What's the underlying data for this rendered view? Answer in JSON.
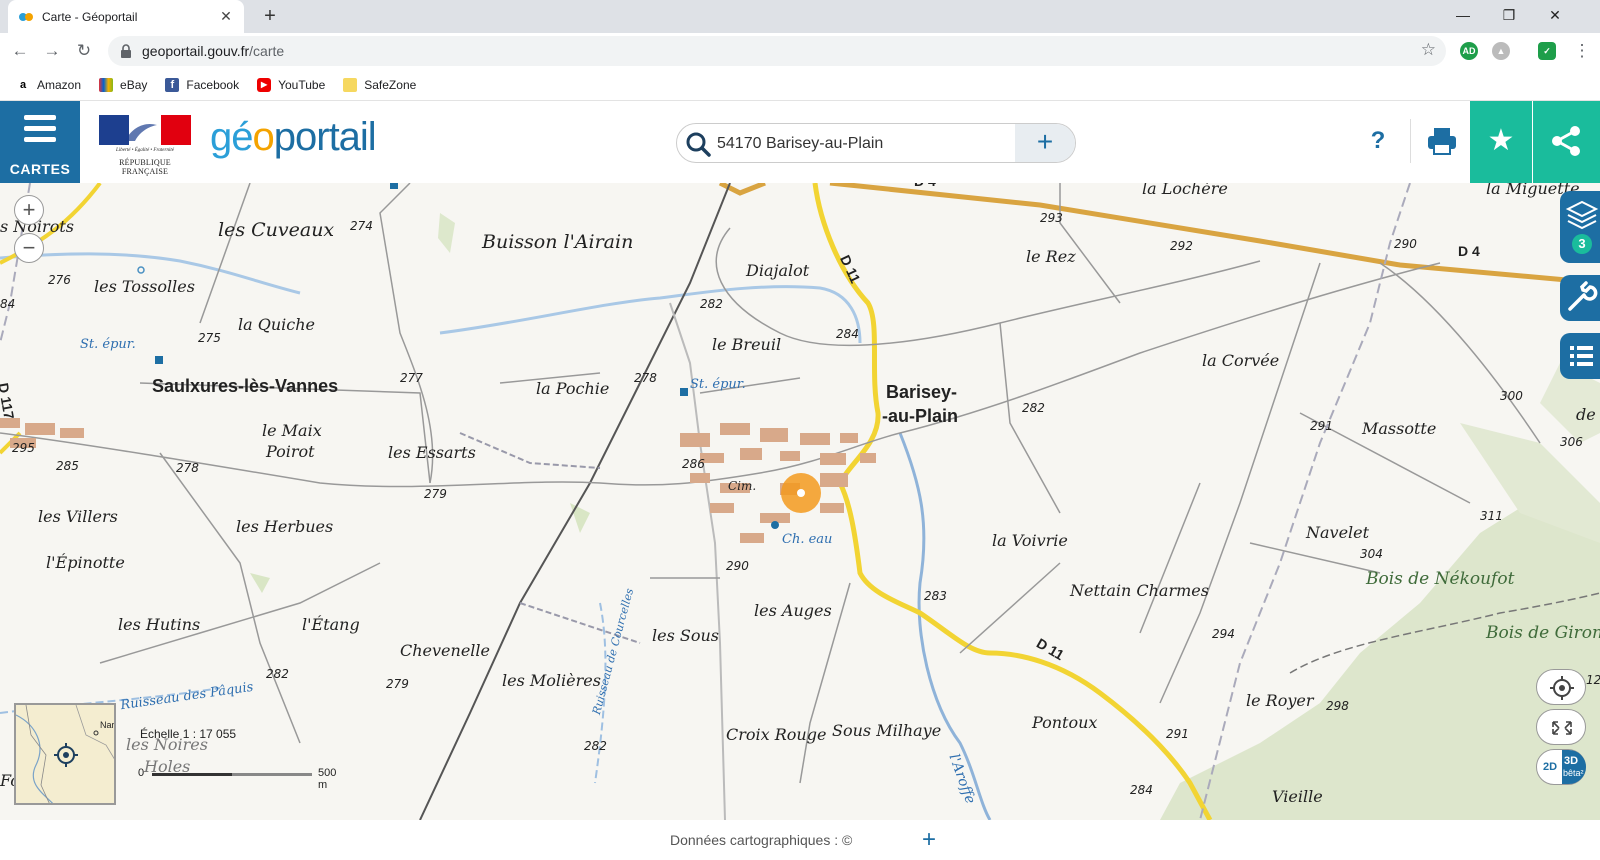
{
  "browser": {
    "tab_title": "Carte - Géoportail",
    "url_host": "geoportail.gouv.fr",
    "url_path": "/carte",
    "bookmarks": [
      "Amazon",
      "eBay",
      "Facebook",
      "YouTube",
      "SafeZone"
    ]
  },
  "header": {
    "menu_label": "CARTES",
    "rf_motto": "Liberté • Égalité • Fraternité",
    "rf_name": "RÉPUBLIQUE FRANÇAISE",
    "logo": {
      "part1": "gé",
      "part2": "o",
      "part3": "portail"
    },
    "search_value": "54170 Barisey-au-Plain",
    "help_label": "?"
  },
  "map": {
    "towns": {
      "saulxures": "Saulxures-lès-Vannes",
      "barisey1": "Barisey-",
      "barisey2": "-au-Plain"
    },
    "places": {
      "noirots": "s Noirots",
      "cuveaux": "les Cuveaux",
      "buisson": "Buisson l'Airain",
      "diajalot": "Diajalot",
      "lochere": "la Lochère",
      "miguette": "la Miguette",
      "rez": "le Rez",
      "tossolles": "les Tossolles",
      "quiche": "la Quiche",
      "breuil": "le Breuil",
      "pochie": "la Pochie",
      "corvee": "la Corvée",
      "maix1": "le Maix",
      "maix2": "Poirot",
      "essarts": "les Essarts",
      "massotte": "Massotte",
      "villers": "les Villers",
      "herbues": "les Herbues",
      "voivrie": "la Voivrie",
      "navelet": "Navelet",
      "epinotte": "l'Épinotte",
      "nettain": "Nettain Charmes",
      "auges": "les Auges",
      "sous": "les Sous",
      "hutins": "les Hutins",
      "etang": "l'Étang",
      "chevenelle": "Chevenelle",
      "molieres": "les Molières",
      "royer": "le Royer",
      "pontoux": "Pontoux",
      "croix": "Croix Rouge",
      "milhaye": "Sous Milhaye",
      "noires1": "les Noires",
      "noires2": "Holes",
      "vieille": "Vieille",
      "nekoufot": "Bois de Nékoufot",
      "girone": "Bois de Giron",
      "de": "de",
      "fo": "Fo"
    },
    "blue_labels": {
      "stepur1": "St. épur.",
      "stepur2": "St. épur.",
      "cheau": "Ch. eau",
      "cim": "Cim.",
      "ruisseau_paquis": "Ruisseau des Pâquis",
      "ruisseau_courcelles": "Ruisseau de Courcelles",
      "aroffe": "l'Aroffe"
    },
    "roads": {
      "d11a": "D 11",
      "d11b": "D 11",
      "d4a": "D 4",
      "d4b": "D 4",
      "d117": "D 117"
    },
    "altitudes": [
      "274",
      "276",
      "84",
      "275",
      "277",
      "278",
      "282",
      "284",
      "293",
      "292",
      "290",
      "282",
      "300",
      "295",
      "285",
      "278",
      "279",
      "286",
      "290",
      "291",
      "306",
      "311",
      "304",
      "283",
      "294",
      "282",
      "279",
      "298",
      "291",
      "282",
      "284",
      "12"
    ],
    "layer_count": "3",
    "minimap_label": "Nar",
    "scale_text": "Échelle 1 : 17 055",
    "scale_zero": "0",
    "scale_end": "500 m",
    "mode_2d": "2D",
    "mode_3d": "3D",
    "mode_beta": "bêta²"
  },
  "footer": {
    "credit": "Données cartographiques : ©"
  },
  "colors": {
    "accent": "#1d6ea3",
    "teal": "#1abc9c",
    "road_yellow": "#f2d433",
    "road_orange": "#d9a441",
    "marker": "#f39a1e"
  }
}
